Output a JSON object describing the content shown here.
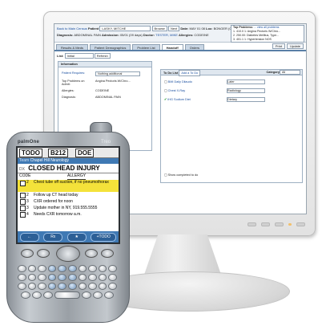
{
  "desktop": {
    "topbar": {
      "back_link": "Back to Main Census",
      "patient_label": "Patient",
      "patient_value": "LASKY, MITCHE",
      "btn_browse": "Browse",
      "btn_next": "Next",
      "date_label": "Date:",
      "date_value": "MAY 01 08",
      "loc_label": "Loc:",
      "loc_value": "BONGER (CEN...",
      "att_label": "Att:",
      "att_value": "SM146",
      "diagnosis_label": "Diagnosis:",
      "diagnosis_value": "ABDOMINAL PAIN",
      "admission_label": "Admission:",
      "admission_value": "05/01 (09 days)",
      "doctor_label": "Doctor:",
      "doctor_value": "TESTER, MIKE",
      "allergies_label": "Allergies:",
      "allergies_value": "CODEINE",
      "top_problems_title": "Top Problems:",
      "top_problems_link": "... view all problems",
      "top_problems": [
        "1. 410.0 1: Angina Pectoris W/Chro...",
        "2. 250.00: Diabetes Mellitus, Type...",
        "3. 401.1 1: Hypertension NOS"
      ]
    },
    "tabs": [
      "Results & Meds",
      "Patient Demographics",
      "Problem List",
      "Handoff",
      "Orders"
    ],
    "active_tab": "Handoff",
    "tools": [
      "Print",
      "Update"
    ],
    "list_label": "List:",
    "list_value": "Initial",
    "refresh_button": "Refresh",
    "info_panel": {
      "title": "Information",
      "patient_label": "Patient Requires:",
      "patient_value": "Nothing additional",
      "problems_label": "Top Problems on Admit:",
      "problems_value": "Angina Pectoris W/Chro...",
      "allergies_label": "Allergies:",
      "allergies_value": "CODEINE",
      "diag_label": "Diagnosis:",
      "diag_value": "ABDOMINAL PAIN"
    },
    "todo_panel": {
      "title_label": "To Do List",
      "title_link": "Add a To Do",
      "category_label": "Category",
      "category_value": "All",
      "items": [
        {
          "text": "BMI Daily Dilaudo",
          "select": "Later",
          "checked": false
        },
        {
          "text": "Chest X-Ray",
          "select": "Radiology",
          "checked": false
        },
        {
          "text": "IHG Sodium Diet",
          "select": "Dietary",
          "checked": true
        }
      ],
      "footer_text": "Show completed to do"
    }
  },
  "pda": {
    "brand": "palmOne",
    "model": "Treo",
    "header": {
      "tab1": "TODO",
      "tab2": "B212",
      "tab3": "DOE"
    },
    "team_label": "Team",
    "team_value": "Chapel Hill Neurology",
    "dx_label": "DX",
    "dx_value": "CLOSED HEAD INJURY",
    "code_label": "CODE",
    "allergy_label": "ALLERGY",
    "items": [
      {
        "num": "2",
        "text": "Chest tube off suction, if no pneumothorax",
        "highlight": true
      },
      {
        "num": "2",
        "text": "Follow up CT head today",
        "highlight": false
      },
      {
        "num": "3",
        "text": "CXR ordered for noon",
        "highlight": false
      },
      {
        "num": "3",
        "text": "Update mother in NY, 919.555.5555",
        "highlight": false
      },
      {
        "num": "4",
        "text": "Needs CXR tomorrow a.m.",
        "highlight": false
      }
    ],
    "bottom_bar": {
      "back": "←",
      "rx": "Rx",
      "star": "★",
      "todo": "+TODO"
    }
  }
}
